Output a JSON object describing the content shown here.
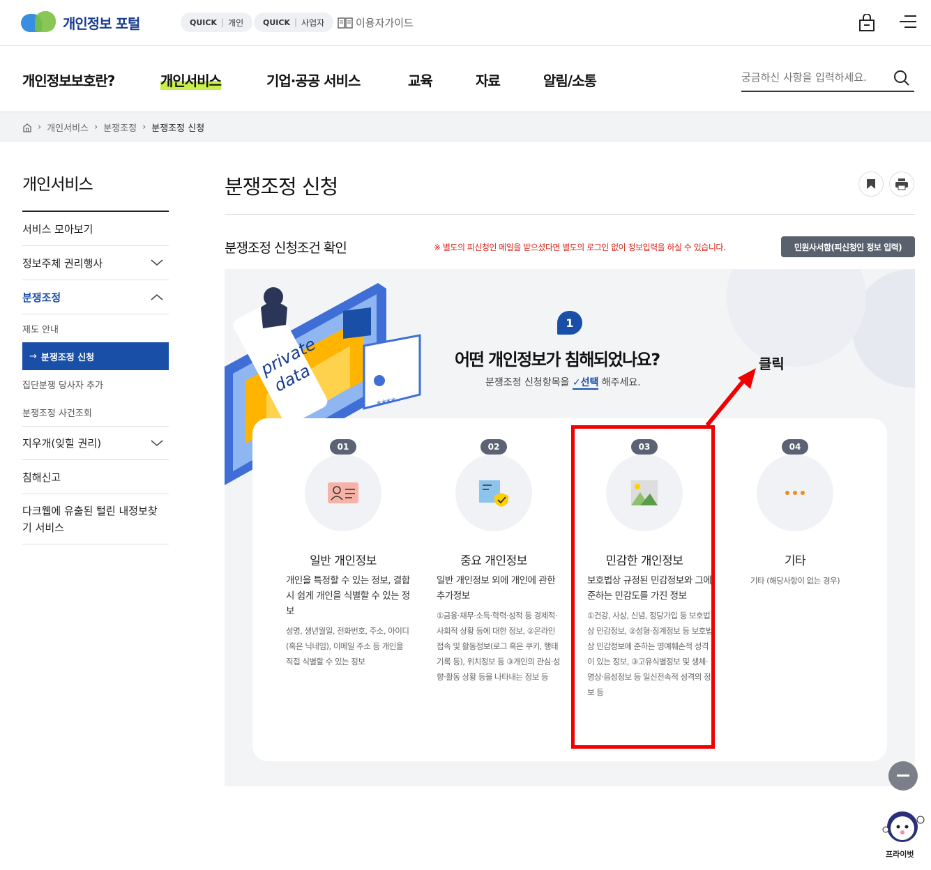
{
  "header": {
    "logo_text": "개인정보 포털",
    "quick_personal": {
      "tag": "QUICK",
      "label": "개인"
    },
    "quick_business": {
      "tag": "QUICK",
      "label": "사업자"
    },
    "guide_label": "이용자가이드"
  },
  "nav": {
    "items": [
      "개인정보보호란?",
      "개인서비스",
      "기업·공공 서비스",
      "교육",
      "자료",
      "알림/소통"
    ],
    "active": "개인서비스",
    "search_placeholder": "궁금하신 사항을 입력하세요."
  },
  "breadcrumb": [
    "개인서비스",
    "분쟁조정",
    "분쟁조정 신청"
  ],
  "sidebar": {
    "title": "개인서비스",
    "items": [
      {
        "label": "서비스 모아보기"
      },
      {
        "label": "정보주체 권리행사"
      },
      {
        "label": "분쟁조정"
      },
      {
        "label": "지우개(잊힐 권리)"
      },
      {
        "label": "침해신고"
      },
      {
        "label": "다크웹에 유출된 털린 내정보찾기 서비스"
      }
    ],
    "sub_items": [
      "제도 안내",
      "분쟁조정 신청",
      "집단분쟁 당사자 추가",
      "분쟁조정 사건조회"
    ],
    "active_sub_prefix": "→"
  },
  "main": {
    "page_title": "분쟁조정 신청",
    "section_title": "분쟁조정 신청조건 확인",
    "notice": "※ 별도의 피신청인 메일을 받으셨다면 별도의 로그인 없이 정보입력을 하실 수 있습니다.",
    "form_button": "민원사서함(피신청인 정보 입력)",
    "illustration_text": [
      "private",
      "data",
      "****"
    ],
    "step_number": "1",
    "question": "어떤 개인정보가 침해되었나요?",
    "question_sub_pre": "분쟁조정 신청항목을",
    "question_sub_sel": "선택",
    "question_sub_post": "해주세요.",
    "annotation": "클릭",
    "cards": [
      {
        "num": "01",
        "title": "일반 개인정보",
        "desc": "개인을 특정할 수 있는 정보, 결합시 쉽게 개인을 식별할 수 있는 정보",
        "detail": "성명, 생년월일, 전화번호, 주소, 아이디(혹은 닉네임), 이메일 주소 등 개인을 직접 식별할 수 있는 정보",
        "icon": "id-card-icon"
      },
      {
        "num": "02",
        "title": "중요 개인정보",
        "desc": "일반 개인정보 외에 개인에 관한 추가정보",
        "detail": "①금융·채무·소득·학력·성적 등 경제적·사회적 상황 등에 대한 정보, ②온라인 접속 및 활동정보(로그 혹은 쿠키, 행태 기록 등), 위치정보 등 ③개인의 관심·성향·활동 상황 등을 나타내는 정보 등",
        "icon": "document-shield-icon"
      },
      {
        "num": "03",
        "title": "민감한 개인정보",
        "desc": "보호법상 규정된 민감정보와 그에 준하는 민감도를 가진 정보",
        "detail": "①건강, 사상, 신념, 정당가입 등 보호법 상 민감정보, ②성형·징계정보 등 보호법상 민감정보에 준하는 명예훼손적 성격이 있는 정보, ③고유식별정보 및 생체·영상·음성정보 등 일신전속적 성격의 정보 등",
        "icon": "image-icon"
      },
      {
        "num": "04",
        "title": "기타",
        "desc": "",
        "detail": "기타 (해당사항이 없는 경우)",
        "icon": "more-icon"
      }
    ]
  },
  "floating": {
    "mascot_label": "프라이벗"
  },
  "colors": {
    "primary": "#1a4fa8",
    "highlight": "#c8f04a",
    "annotation": "#f10000",
    "notice": "#d9261c"
  }
}
